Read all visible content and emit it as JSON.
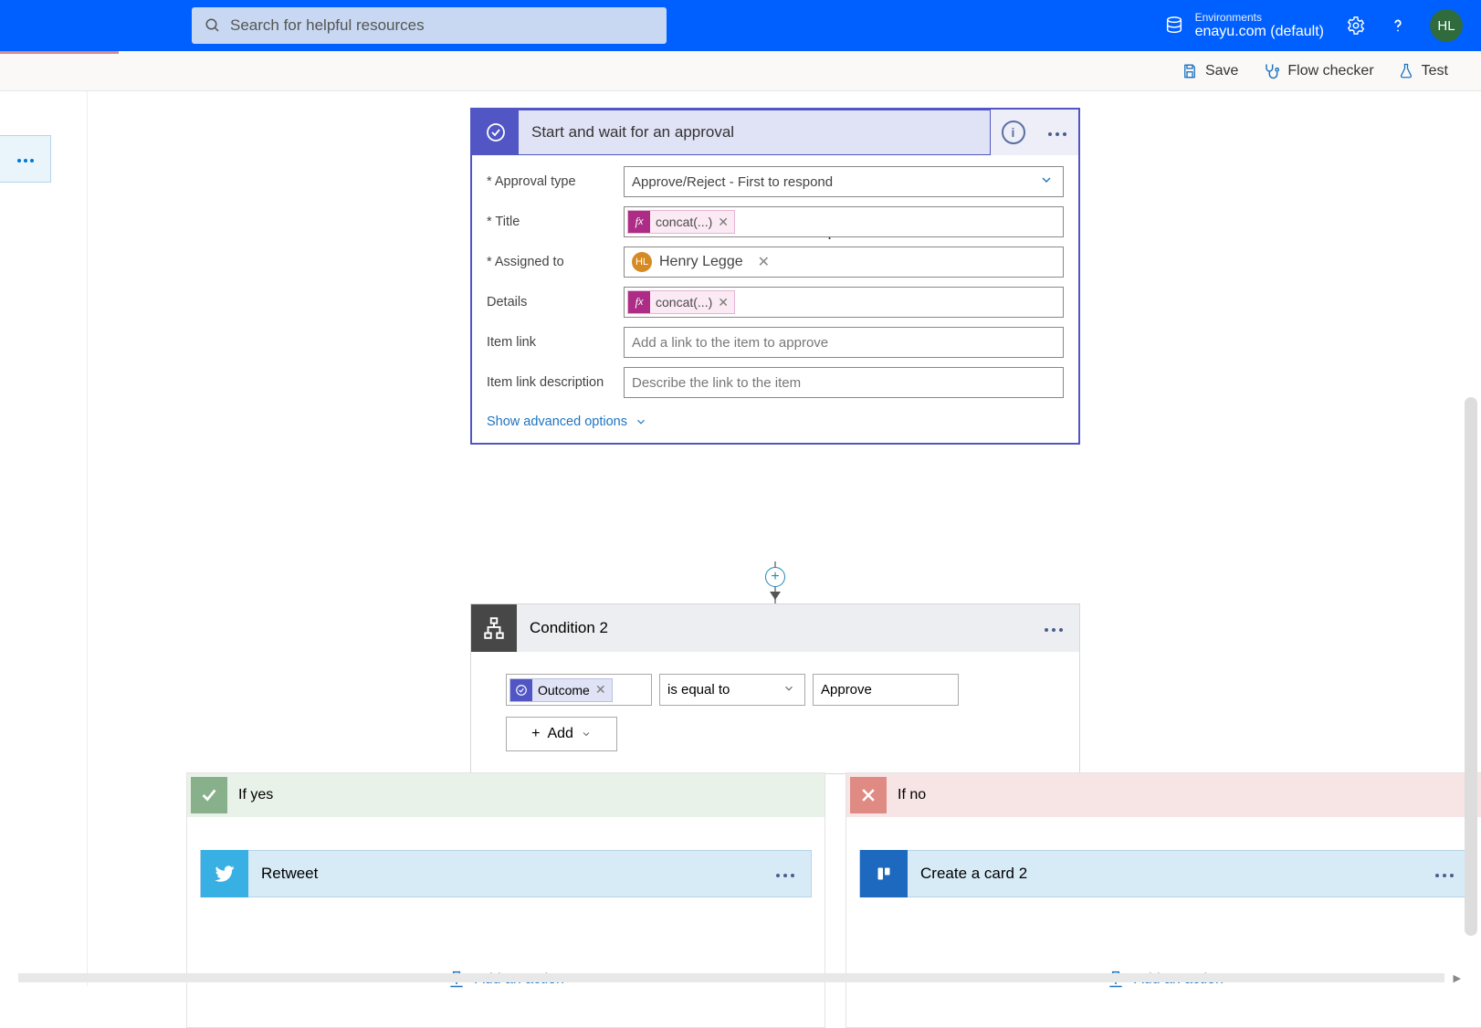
{
  "header": {
    "search_placeholder": "Search for helpful resources",
    "env_label": "Environments",
    "env_value": "enayu.com (default)",
    "avatar_initials": "HL"
  },
  "toolbar": {
    "save": "Save",
    "flow_checker": "Flow checker",
    "test": "Test"
  },
  "approval": {
    "title": "Start and wait for an approval",
    "fields": {
      "approval_type_label": "* Approval type",
      "approval_type_value": "Approve/Reject - First to respond",
      "title_label": "* Title",
      "title_token": "concat(...)",
      "assigned_label": "* Assigned to",
      "assigned_person": "Henry Legge",
      "assigned_person_initials": "HL",
      "details_label": "Details",
      "details_token": "concat(...)",
      "item_link_label": "Item link",
      "item_link_placeholder": "Add a link to the item to approve",
      "item_link_desc_label": "Item link description",
      "item_link_desc_placeholder": "Describe the link to the item",
      "advanced": "Show advanced options"
    }
  },
  "condition": {
    "title": "Condition 2",
    "outcome_label": "Outcome",
    "operator": "is equal to",
    "value": "Approve",
    "add_label": "Add"
  },
  "branches": {
    "yes_label": "If yes",
    "no_label": "If no",
    "retweet_title": "Retweet",
    "trello_title": "Create a card 2",
    "add_action": "Add an action"
  }
}
